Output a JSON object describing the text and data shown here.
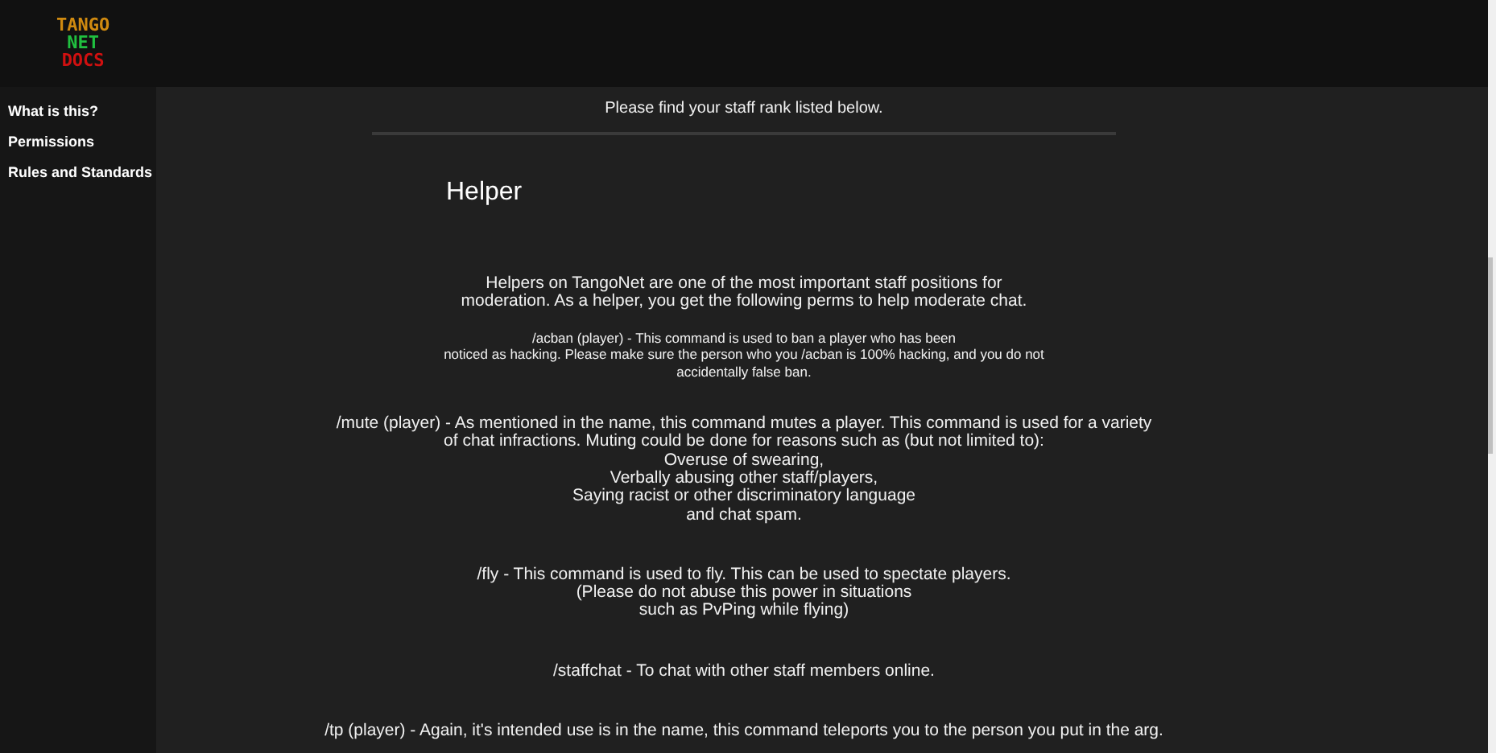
{
  "logo": {
    "lines": [
      "TANGO",
      "NET",
      "DOCS"
    ]
  },
  "sidebar": {
    "items": [
      {
        "label": "What is this?"
      },
      {
        "label": "Permissions"
      },
      {
        "label": "Rules and Standards"
      }
    ]
  },
  "intro": "Please find your staff rank listed below.",
  "heading": "Helper",
  "paragraphs": [
    {
      "kind": "large",
      "lines": [
        "Helpers on TangoNet are one of the most important staff positions for",
        "moderation. As a helper, you get the following perms to help moderate chat."
      ]
    },
    {
      "kind": "small",
      "lines": [
        "/acban (player) - This command is used to ban a player who has been",
        "noticed as hacking. Please make sure the person who you /acban is 100% hacking, and you do not",
        "accidentally false ban."
      ]
    },
    {
      "kind": "large",
      "lines": [
        "/mute (player) - As mentioned in the name, this command mutes a player. This command is used for a variety",
        "of chat infractions. Muting could be done for reasons such as (but not limited to):",
        "Overuse of swearing,",
        "Verbally abusing other staff/players,",
        "Saying racist or other discriminatory language",
        "and chat spam."
      ]
    },
    {
      "kind": "large",
      "lines": [
        "/fly - This command is used to fly. This can be used to spectate players.",
        "(Please do not abuse this power in situations",
        "such as PvPing while flying)"
      ]
    },
    {
      "kind": "large",
      "lines": [
        "/staffchat - To chat with other staff members online."
      ]
    },
    {
      "kind": "large",
      "lines": [
        "/tp (player) - Again, it's intended use is in the name, this command teleports you to the person you put in the arg."
      ]
    }
  ]
}
